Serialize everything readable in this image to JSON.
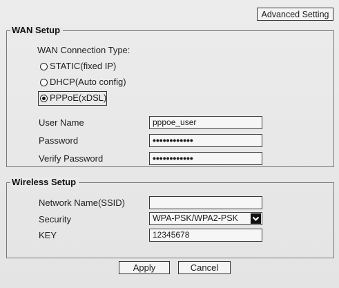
{
  "header": {
    "advanced_label": "Advanced Setting"
  },
  "wan": {
    "legend": "WAN Setup",
    "connection_type_label": "WAN Connection Type:",
    "options": [
      {
        "label": "STATIC(fixed IP)",
        "selected": false
      },
      {
        "label": "DHCP(Auto config)",
        "selected": false
      },
      {
        "label": "PPPoE(xDSL)",
        "selected": true
      }
    ],
    "user_name_label": "User Name",
    "user_name_value": "pppoe_user",
    "password_label": "Password",
    "password_value": "••••••••••••",
    "verify_label": "Verify Password",
    "verify_value": "••••••••••••"
  },
  "wireless": {
    "legend": "Wireless Setup",
    "ssid_label": "Network Name(SSID)",
    "ssid_value": "",
    "security_label": "Security",
    "security_value": "WPA-PSK/WPA2-PSK",
    "key_label": "KEY",
    "key_value": "12345678"
  },
  "footer": {
    "apply_label": "Apply",
    "cancel_label": "Cancel"
  }
}
